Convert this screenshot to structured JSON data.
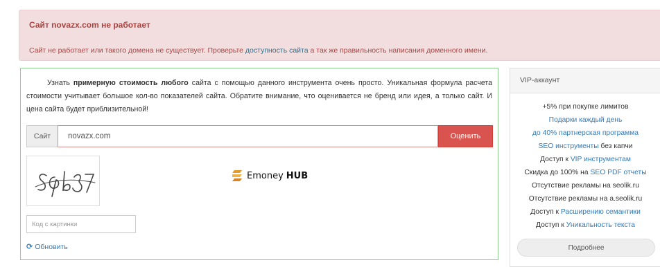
{
  "alert": {
    "title": "Сайт novazx.com не работает",
    "text_before": "Сайт не работает или такого домена не существует. Проверьте ",
    "link": "доступность сайта",
    "text_after": " а так же правильность написания доменного имени."
  },
  "main": {
    "intro_1": "Узнать ",
    "intro_bold": "примерную стоимость любого",
    "intro_2": " сайта с помощью данного инструмента очень просто. Уникальная формула расчета стоимости учитывает большое кол-во показателей сайта. Обратите внимание, что оценивается не бренд или идея, а только сайт. И цена сайта будет приблизительной!",
    "site_label": "Сайт",
    "site_value": "novazx.com",
    "submit_label": "Оценить",
    "captcha_placeholder": "Код с картинки",
    "refresh_label": "Обновить",
    "refresh_icon": "refresh-icon"
  },
  "watermark": {
    "name": "Emoney",
    "suffix": "HUB"
  },
  "vip": {
    "title": "VIP-аккаунт",
    "items": [
      {
        "text": "+5% при покупке лимитов",
        "link": "",
        "after": ""
      },
      {
        "text": "",
        "link": "Подарки каждый день",
        "after": ""
      },
      {
        "text": "",
        "link": "до 40% партнерская программа",
        "after": ""
      },
      {
        "text": "",
        "link": "SEO инструменты",
        "after": " без капчи"
      },
      {
        "text": "Доступ к ",
        "link": "VIP инструментам",
        "after": ""
      },
      {
        "text": "Скидка до 100% на ",
        "link": "SEO PDF отчеты",
        "after": ""
      },
      {
        "text": "Отсутствие рекламы на seolik.ru",
        "link": "",
        "after": ""
      },
      {
        "text": "Отсутствие рекламы на a.seolik.ru",
        "link": "",
        "after": ""
      },
      {
        "text": "Доступ к ",
        "link": "Расширению семантики",
        "after": ""
      },
      {
        "text": "Доступ к ",
        "link": "Уникальность текста",
        "after": ""
      }
    ],
    "more_label": "Подробнее"
  },
  "colors": {
    "alert_bg": "#f2dede",
    "alert_text": "#a94442",
    "link": "#337ab7",
    "button_red": "#d9534f",
    "panel_border": "#8fcf8f"
  }
}
